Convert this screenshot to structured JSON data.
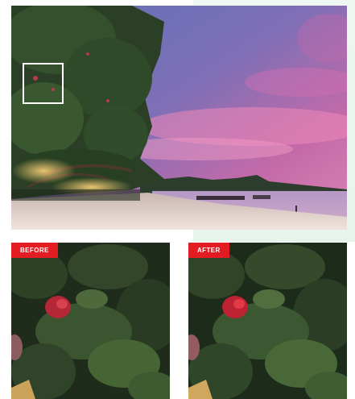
{
  "comparison": {
    "before_label": "BEFORE",
    "after_label": "AFTER"
  },
  "colors": {
    "label_background": "#e31b23",
    "label_text": "#ffffff",
    "marker": "#ffffff"
  }
}
